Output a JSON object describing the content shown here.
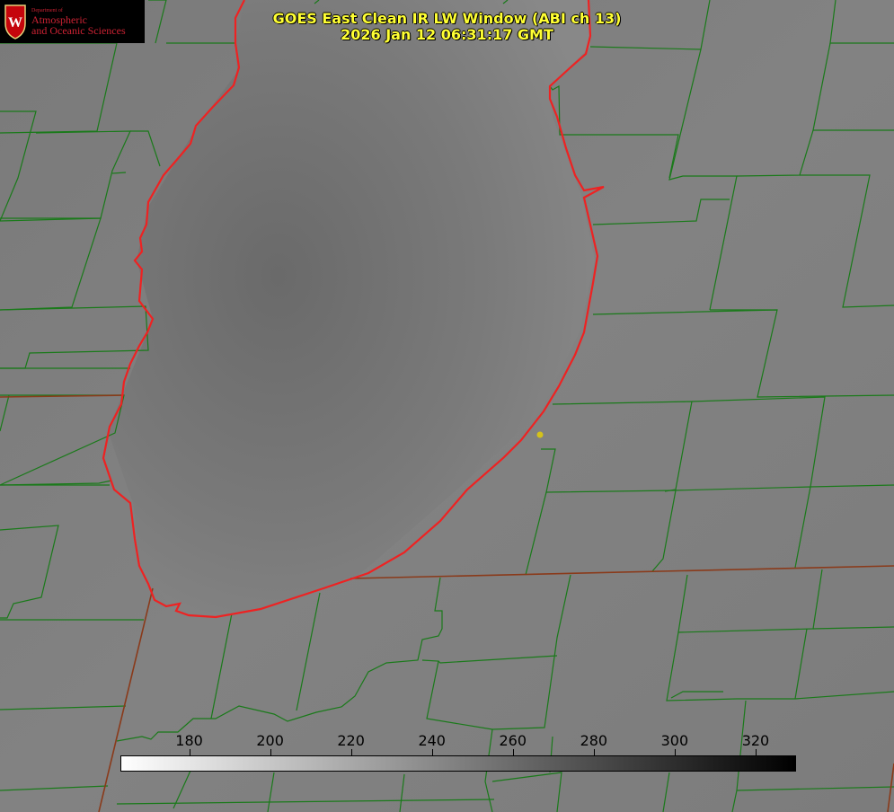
{
  "header": {
    "title_line1": "GOES East Clean IR LW Window (ABI ch 13)",
    "title_line2": "2026 Jan 12 06:31:17 GMT"
  },
  "logo": {
    "department": "Department of",
    "line1": "Atmospheric",
    "line2": "and Oceanic Sciences",
    "crest_letter": "W"
  },
  "colorbar": {
    "ticks": [
      "180",
      "200",
      "220",
      "240",
      "260",
      "280",
      "300",
      "320"
    ],
    "tick_values": [
      180,
      200,
      220,
      240,
      260,
      280,
      300,
      320
    ],
    "range": [
      163,
      330
    ],
    "colors": {
      "low": "#ffffff",
      "high": "#000000"
    }
  },
  "colors": {
    "county_lines": "#1a7a1a",
    "shoreline": "#ee2222",
    "state_border": "#8a3a1a",
    "title": "#ffff33",
    "marker": "#d4c21a"
  }
}
